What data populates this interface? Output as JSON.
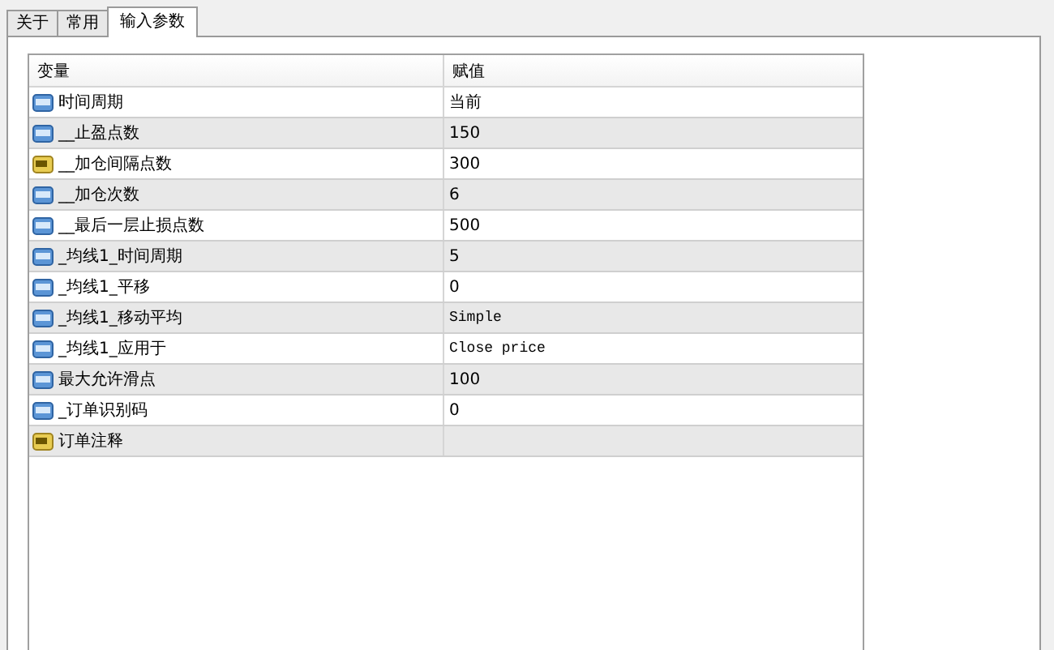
{
  "tabs": [
    {
      "label": "关于",
      "selected": false
    },
    {
      "label": "常用",
      "selected": false
    },
    {
      "label": "输入参数",
      "selected": true
    }
  ],
  "table": {
    "columns": [
      "变量",
      "赋值"
    ],
    "rows": [
      {
        "kind": "number",
        "name": "时间周期",
        "value": "当前"
      },
      {
        "kind": "number",
        "name": "__止盈点数",
        "value": "150"
      },
      {
        "kind": "text",
        "name": "__加仓间隔点数",
        "value": "300"
      },
      {
        "kind": "number",
        "name": "__加仓次数",
        "value": "6"
      },
      {
        "kind": "number",
        "name": "__最后一层止损点数",
        "value": "500"
      },
      {
        "kind": "number",
        "name": "_均线1_时间周期",
        "value": "5"
      },
      {
        "kind": "number",
        "name": "_均线1_平移",
        "value": "0"
      },
      {
        "kind": "number",
        "name": "_均线1_移动平均",
        "value": "Simple"
      },
      {
        "kind": "number",
        "name": "_均线1_应用于",
        "value": "Close price"
      },
      {
        "kind": "number",
        "name": "最大允许滑点",
        "value": "100"
      },
      {
        "kind": "number",
        "name": "_订单识别码",
        "value": "0"
      },
      {
        "kind": "text",
        "name": "订单注释",
        "value": ""
      }
    ]
  }
}
